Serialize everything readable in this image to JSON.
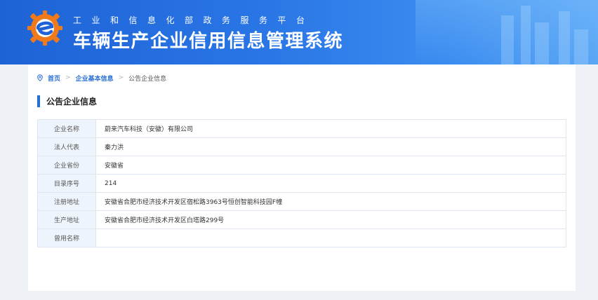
{
  "header": {
    "ministry": "工业和信息化部政务服务平台",
    "title": "车辆生产企业信用信息管理系统",
    "logo_icon": "gear-e-logo-icon",
    "colors": {
      "banner": "#2a76e6",
      "logo_orange": "#f07a1a",
      "logo_blue": "#1e63d6"
    }
  },
  "breadcrumb": {
    "icon": "location-pin-icon",
    "home": "首页",
    "section": "企业基本信息",
    "current": "公告企业信息"
  },
  "section": {
    "title": "公告企业信息"
  },
  "info_rows": [
    {
      "label": "企业名称",
      "value": "蔚来汽车科技（安徽）有限公司"
    },
    {
      "label": "法人代表",
      "value": "秦力洪"
    },
    {
      "label": "企业省份",
      "value": "安徽省"
    },
    {
      "label": "目录序号",
      "value": "214"
    },
    {
      "label": "注册地址",
      "value": "安徽省合肥市经济技术开发区宿松路3963号恒创智能科技园F幢"
    },
    {
      "label": "生产地址",
      "value": "安徽省合肥市经济技术开发区白塔路299号"
    },
    {
      "label": "曾用名称",
      "value": ""
    }
  ]
}
